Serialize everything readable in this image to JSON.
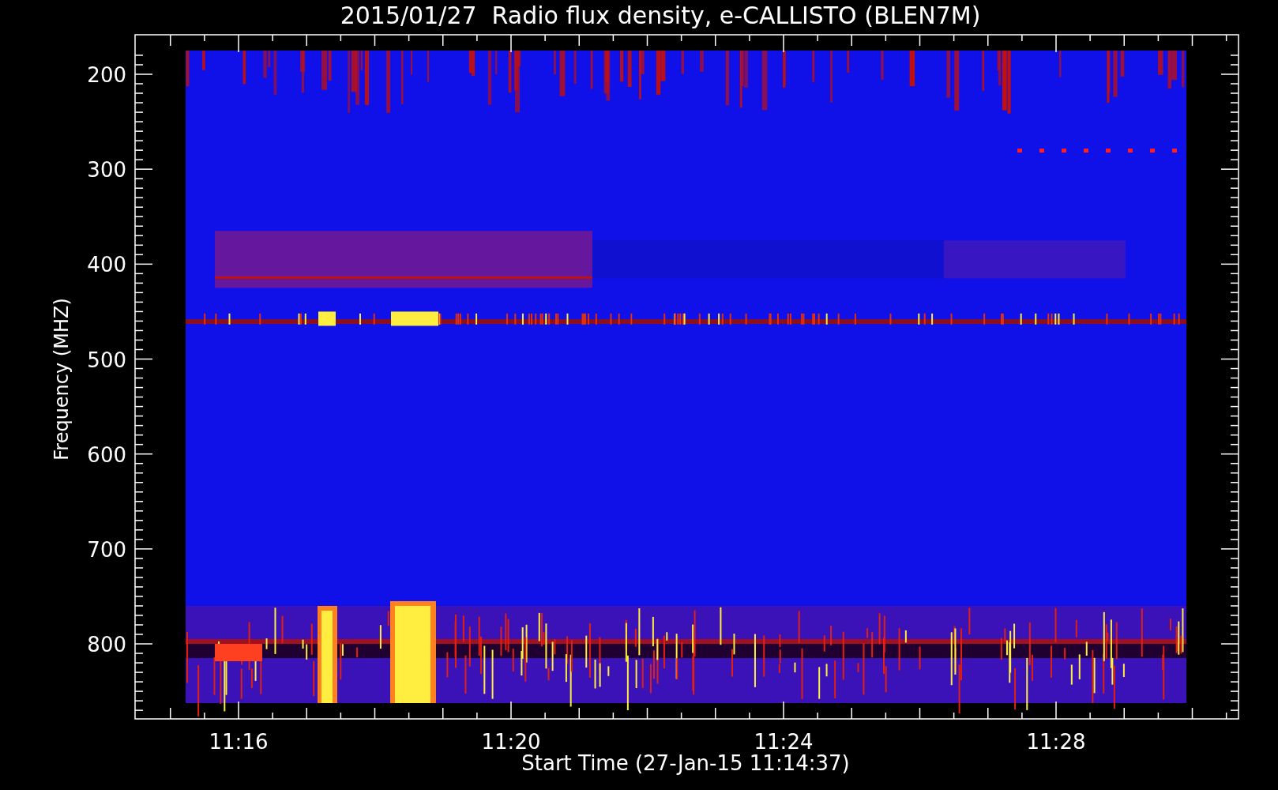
{
  "title": "2015/01/27  Radio flux density, e-CALLISTO (BLEN7M)",
  "y_axis": {
    "label": "Frequency (MHZ)",
    "ticks": [
      "200",
      "300",
      "400",
      "500",
      "600",
      "700",
      "800"
    ]
  },
  "x_axis": {
    "label": "Start Time (27-Jan-15 11:14:37)",
    "ticks": [
      "11:16",
      "11:20",
      "11:24",
      "11:28"
    ]
  }
}
